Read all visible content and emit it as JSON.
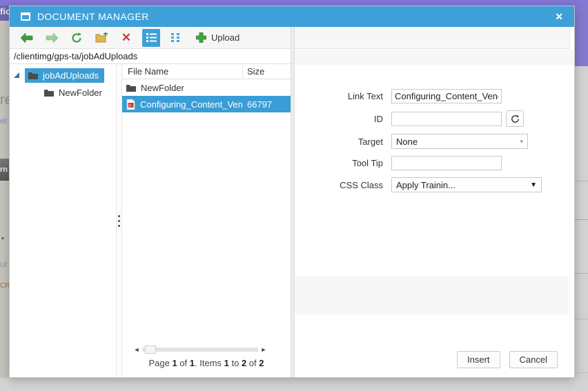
{
  "window": {
    "title": "DOCUMENT MANAGER",
    "close_glyph": "✕"
  },
  "toolbar": {
    "upload_label": "Upload"
  },
  "breadcrumb": {
    "path": "/clientimg/gps-ta/jobAdUploads"
  },
  "tree": {
    "items": [
      {
        "label": "jobAdUploads",
        "selected": true
      },
      {
        "label": "NewFolder",
        "selected": false
      }
    ]
  },
  "grid": {
    "columns": {
      "file_name": "File Name",
      "size": "Size"
    },
    "rows": [
      {
        "file_name": "NewFolder",
        "size": "",
        "icon": "folder-icon",
        "selected": false
      },
      {
        "file_name": "Configuring_Content_Vendor",
        "size": "66797",
        "icon": "pdf-file-icon",
        "selected": true
      }
    ]
  },
  "scrollbar": {
    "left_arrow": "◄",
    "right_arrow": "►"
  },
  "pager": {
    "parts": [
      "Page ",
      "1",
      " of ",
      "1",
      ". Items ",
      "1",
      " to ",
      "2",
      " of ",
      "2"
    ]
  },
  "form": {
    "link_text": {
      "label": "Link Text",
      "value": "Configuring_Content_Vendor"
    },
    "id": {
      "label": "ID",
      "value": ""
    },
    "target": {
      "label": "Target",
      "value": "None"
    },
    "tool_tip": {
      "label": "Tool Tip",
      "value": ""
    },
    "css_class": {
      "label": "CSS Class",
      "value": "Apply Trainin..."
    }
  },
  "footer": {
    "insert": "Insert",
    "cancel": "Cancel"
  },
  "background_fragments": {
    "fic": "fic",
    "re": "re",
    "el": "el:",
    "rn": "rn",
    "dot": "▪",
    "ui": "UI'",
    "cri": "CRI"
  },
  "colors": {
    "titlebar_blue": "#3da0d8",
    "selection_blue": "#3a9dd6",
    "page_purple": "#8477d6"
  }
}
